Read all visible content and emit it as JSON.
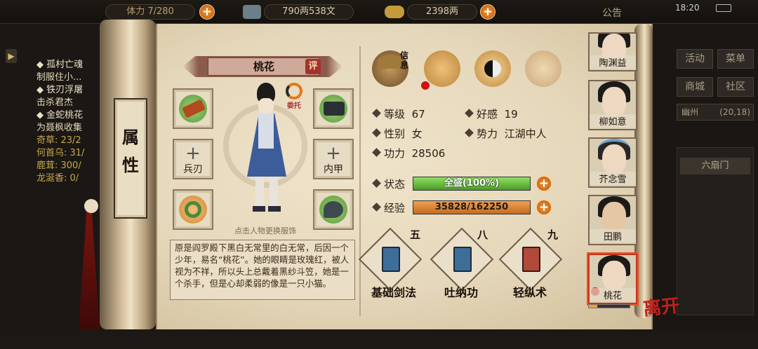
{
  "topbar": {
    "stamina": "7/280",
    "stamina_prefix": "体力",
    "copper": "790两538文",
    "silver": "2398两",
    "notice": "公告",
    "time": "18:20"
  },
  "quests": [
    {
      "title": "孤村亡魂",
      "detail": "制服住小..."
    },
    {
      "title": "铁刃浮屠",
      "detail": "击杀君杰"
    },
    {
      "title": "金蛇桃花",
      "detail": "为聂枫收集"
    },
    {
      "detail2": "奇草: 23/2"
    },
    {
      "detail2": "何首乌: 31/"
    },
    {
      "detail2": "鹿茸: 300/"
    },
    {
      "detail2": "龙涎香: 0/"
    }
  ],
  "right_menu": {
    "activity": "活动",
    "menu": "菜单",
    "shop": "商城",
    "community": "社区",
    "location": "幽州",
    "coords": "(20,18)",
    "map_label": "六扇门"
  },
  "side_tab": {
    "line1": "属",
    "line2": "性"
  },
  "character": {
    "name": "桃花",
    "rate_label": "评",
    "change_label": "委托",
    "hint": "点击人物更换服饰",
    "description": "原是阎罗殿下黑白无常里的白无常，后因一个少年，易名“桃花”。她的眼睛是玫瑰红，被人视为不祥，所以头上总戴着黑纱斗笠，她是一个杀手，但是心却柔弱的像是一只小猫。"
  },
  "equipment": {
    "weapon_label": "兵刃",
    "armor_label": "内甲"
  },
  "tabs": {
    "info_label": "信息"
  },
  "stats": {
    "level_label": "等级",
    "level": "67",
    "favor_label": "好感",
    "favor": "19",
    "gender_label": "性别",
    "gender": "女",
    "faction_label": "势力",
    "faction": "江湖中人",
    "power_label": "功力",
    "power": "28506",
    "status_label": "状态",
    "status_value": "全盛(100%)",
    "status_fraction": 1.0,
    "exp_label": "经验",
    "exp_value": "35828/162250",
    "exp_fraction": 0.2208
  },
  "skills": [
    {
      "name": "基础剑法",
      "level": "五"
    },
    {
      "name": "吐纳功",
      "level": "八"
    },
    {
      "name": "轻纵术",
      "level": "九"
    }
  ],
  "roster": [
    {
      "name": "陶渊益"
    },
    {
      "name": "柳如意"
    },
    {
      "name": "芥念雪"
    },
    {
      "name": "田鹏"
    },
    {
      "name": "桃花"
    }
  ],
  "leave_label": "离开",
  "colors": {
    "status_bar": "#5fbf3a",
    "exp_bar": "#d9772a",
    "plus_button": "#e8862a",
    "parchment": "#e8dcc0",
    "name_banner": "#8a5a4a"
  }
}
